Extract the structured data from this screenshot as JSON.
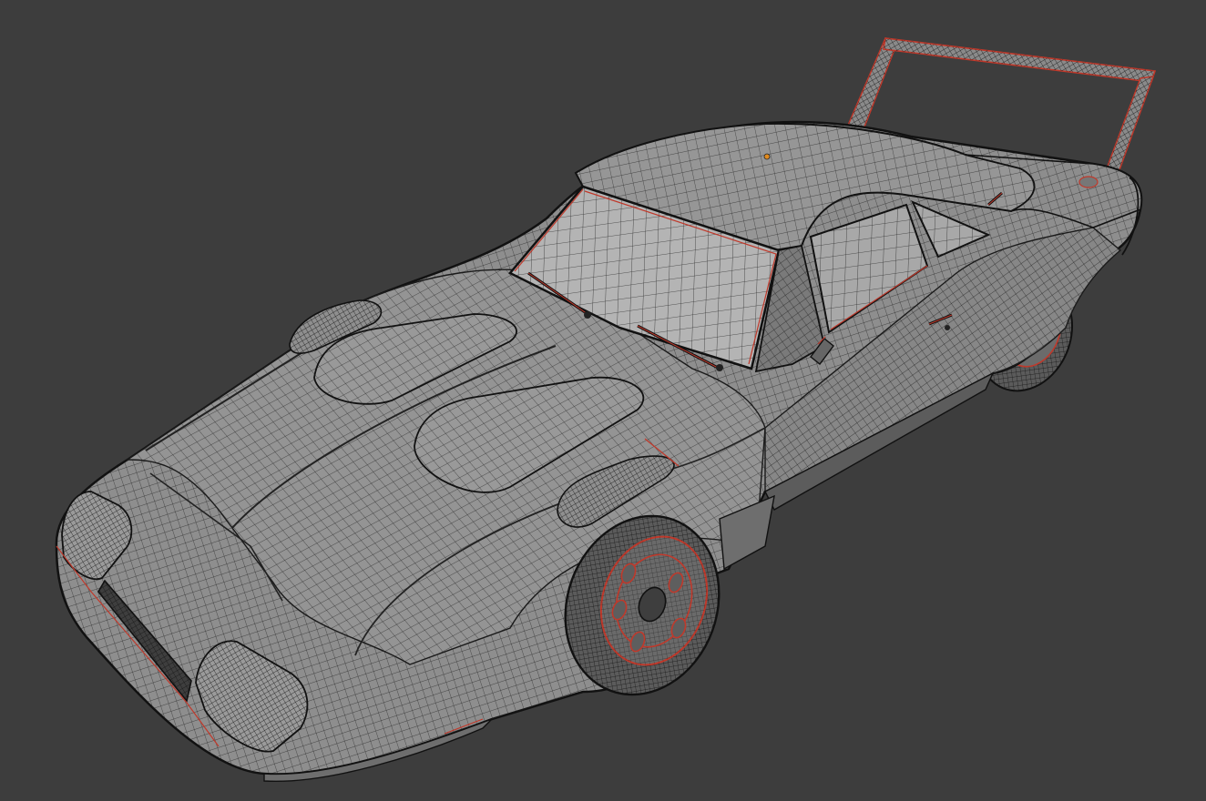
{
  "viewport": {
    "background": "#3d3d3d",
    "shading": "solid-gray-with-wireframe-overlay"
  },
  "model": {
    "name": "",
    "body_color": "#8e8e8e",
    "wire_color": "#1c1c1c",
    "seam_color": "#d0392b",
    "parts": [
      "body",
      "roof",
      "windshield",
      "side-windows",
      "hood-scoops",
      "headlights",
      "grille",
      "rear-wing",
      "front-wheel",
      "rear-wheel",
      "door-handle",
      "side-mirror",
      "wipers",
      "origin-point"
    ]
  },
  "origin_point": {
    "color": "#e08a1e"
  }
}
